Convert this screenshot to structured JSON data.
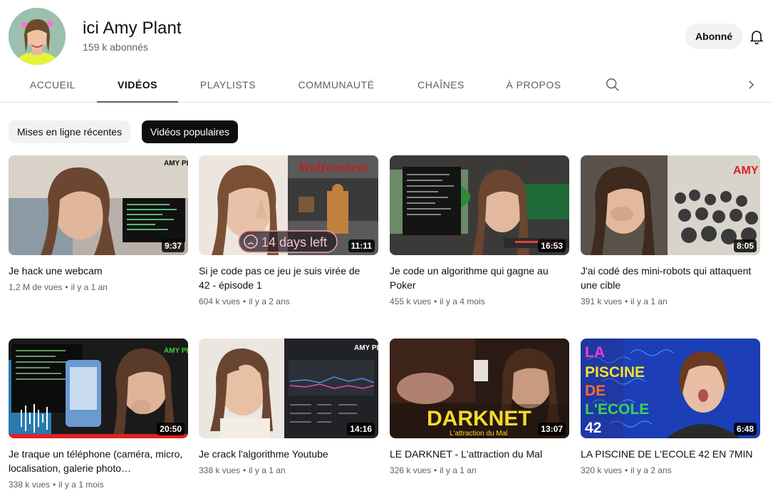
{
  "channel": {
    "name": "ici Amy Plant",
    "subscribers": "159 k abonnés",
    "subscribe_label": "Abonné"
  },
  "tabs": [
    {
      "label": "ACCUEIL",
      "active": false
    },
    {
      "label": "VIDÉOS",
      "active": true
    },
    {
      "label": "PLAYLISTS",
      "active": false
    },
    {
      "label": "COMMUNAUTÉ",
      "active": false
    },
    {
      "label": "CHAÎNES",
      "active": false
    },
    {
      "label": "À PROPOS",
      "active": false
    }
  ],
  "chips": [
    {
      "label": "Mises en ligne récentes",
      "selected": false
    },
    {
      "label": "Vidéos populaires",
      "selected": true
    }
  ],
  "videos": [
    {
      "title": "Je hack une webcam",
      "views": "1,2 M de vues",
      "age": "il y a 1 an",
      "duration": "9:37",
      "thumb_brand": "AMY PLANT"
    },
    {
      "title": "Si je code pas ce jeu je suis virée de 42 - épisode 1",
      "views": "604 k vues",
      "age": "il y a 2 ans",
      "duration": "11:11",
      "thumb_text": "14 days left",
      "thumb_logo": "Wolfenstein"
    },
    {
      "title": "Je code un algorithme qui gagne au Poker",
      "views": "455 k vues",
      "age": "il y a 4 mois",
      "duration": "16:53"
    },
    {
      "title": "J'ai codé des mini-robots qui attaquent une cible",
      "views": "391 k vues",
      "age": "il y a 1 an",
      "duration": "8:05",
      "thumb_brand": "AMY PLANT"
    },
    {
      "title": "Je traque un téléphone (caméra, micro, localisation, galerie photo…",
      "views": "338 k vues",
      "age": "il y a 1 mois",
      "duration": "20:50",
      "thumb_brand": "AMY PLANT"
    },
    {
      "title": "Je crack l'algorithme Youtube",
      "views": "338 k vues",
      "age": "il y a 1 an",
      "duration": "14:16",
      "thumb_brand": "AMY PLANT"
    },
    {
      "title": "LE DARKNET - L'attraction du Mal",
      "views": "326 k vues",
      "age": "il y a 1 an",
      "duration": "13:07",
      "thumb_text": "DARKNET",
      "thumb_subtext": "L'attraction du Mal"
    },
    {
      "title": "LA PISCINE DE L'ECOLE 42 EN 7MIN",
      "views": "320 k vues",
      "age": "il y a 2 ans",
      "duration": "6:48",
      "thumb_lines": [
        "LA",
        "PISCINE",
        "DE",
        "L'ECOLE",
        "42"
      ]
    }
  ]
}
